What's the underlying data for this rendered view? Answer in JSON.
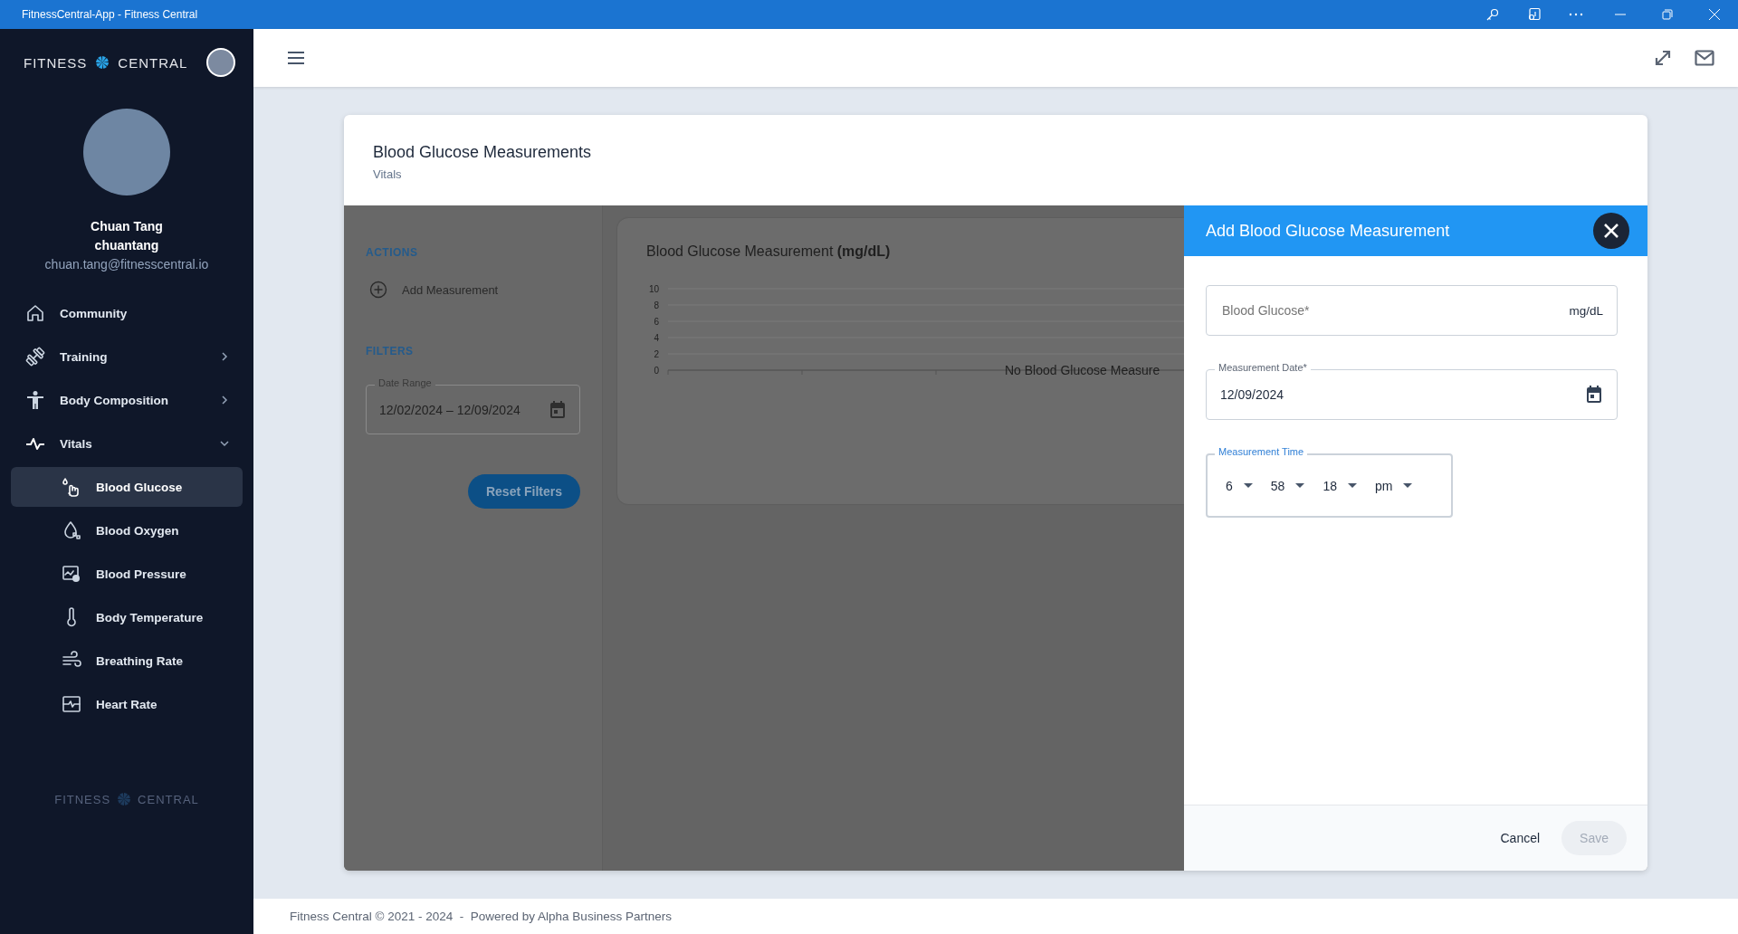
{
  "window": {
    "title": "FitnessCentral-App - Fitness Central"
  },
  "sidebar": {
    "logo": {
      "left": "FITNESS",
      "right": "CENTRAL"
    },
    "user": {
      "name": "Chuan Tang",
      "username": "chuantang",
      "email": "chuan.tang@fitnesscentral.io"
    },
    "items": [
      {
        "label": "Community",
        "selected": false
      },
      {
        "label": "Training",
        "selected": false,
        "expanded": false
      },
      {
        "label": "Body Composition",
        "selected": false,
        "expanded": false
      },
      {
        "label": "Vitals",
        "selected": false,
        "expanded": true,
        "children": [
          {
            "label": "Blood Glucose",
            "selected": true
          },
          {
            "label": "Blood Oxygen",
            "selected": false
          },
          {
            "label": "Blood Pressure",
            "selected": false
          },
          {
            "label": "Body Temperature",
            "selected": false
          },
          {
            "label": "Breathing Rate",
            "selected": false
          },
          {
            "label": "Heart Rate",
            "selected": false
          }
        ]
      }
    ],
    "footer_logo": {
      "left": "FITNESS",
      "right": "CENTRAL"
    }
  },
  "page": {
    "title": "Blood Glucose Measurements",
    "subtitle": "Vitals"
  },
  "actions": {
    "heading": "ACTIONS",
    "items": [
      {
        "label": "Add Measurement"
      }
    ]
  },
  "filters": {
    "heading": "FILTERS",
    "date_range": {
      "label": "Date Range",
      "value": "12/02/2024 – 12/09/2024"
    },
    "reset_button": "Reset Filters"
  },
  "chart": {
    "title": "Blood Glucose Measurement  **(mg/dL)**",
    "y_axis_labels": [
      "10",
      "8",
      "6",
      "4",
      "2",
      "0"
    ],
    "empty_message": "No Blood Glucose Measure"
  },
  "drawer": {
    "title": "Add Blood Glucose Measurement",
    "fields": [
      {
        "kind": "number",
        "placeholder": "Blood Glucose*",
        "unit": "mg/dL"
      },
      {
        "kind": "date",
        "label": "Measurement Date*",
        "value": "12/09/2024"
      },
      {
        "kind": "time",
        "label": "Measurement Time",
        "focused": true,
        "parts": [
          {
            "value": "6"
          },
          {
            "value": "58"
          },
          {
            "value": "18"
          },
          {
            "value": "pm"
          }
        ]
      }
    ],
    "buttons": [
      {
        "label": "Cancel",
        "kind": "text",
        "disabled": false
      },
      {
        "label": "Save",
        "kind": "filled",
        "disabled": true
      }
    ]
  },
  "footer": {
    "text": "Fitness Central © 2021 - 2024  -  Powered by Alpha Business Partners"
  }
}
